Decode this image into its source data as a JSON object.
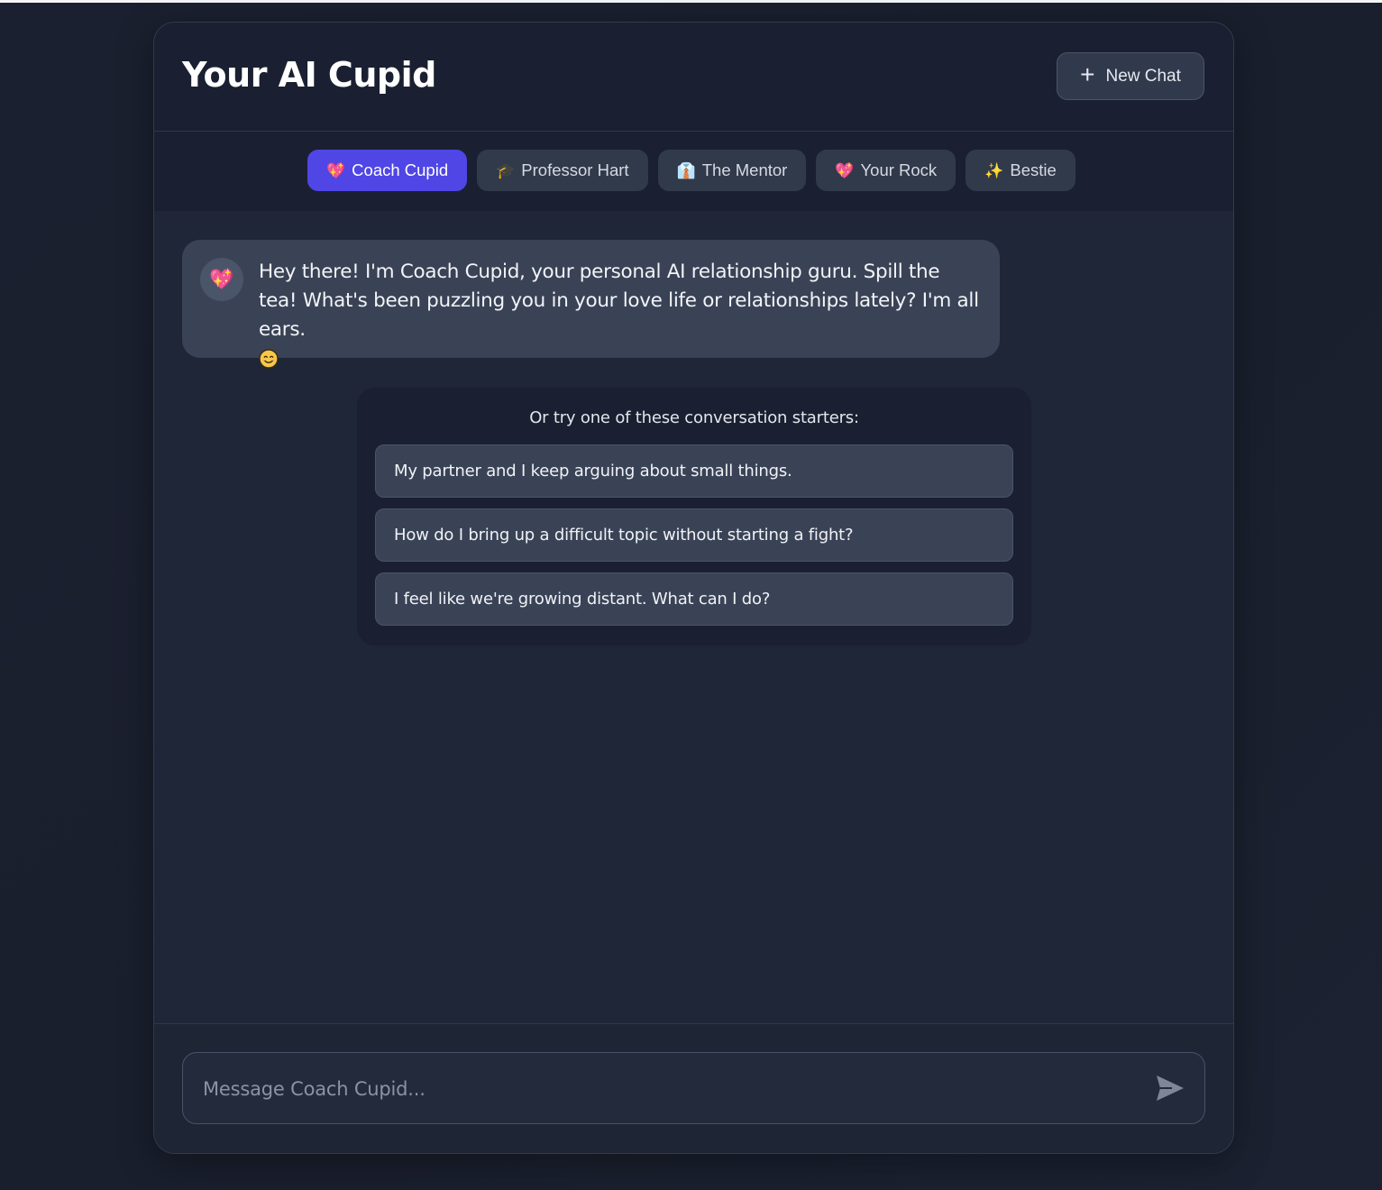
{
  "app": {
    "title": "Your AI Cupid",
    "new_chat_label": "New Chat"
  },
  "tabs": [
    {
      "label": "Coach Cupid",
      "icon": "heart-icon",
      "glyph": "💖",
      "active": true
    },
    {
      "label": "Professor Hart",
      "icon": "graduation-cap-icon",
      "glyph": "🎓",
      "active": false
    },
    {
      "label": "The Mentor",
      "icon": "person-icon",
      "glyph": "👔",
      "active": false
    },
    {
      "label": "Your Rock",
      "icon": "heart-icon",
      "glyph": "💖",
      "active": false
    },
    {
      "label": "Bestie",
      "icon": "sparkles-icon",
      "glyph": "✨",
      "active": false
    }
  ],
  "message": {
    "avatar_icon": "heart-icon",
    "avatar_glyph": "💖",
    "text": "Hey there! I'm Coach Cupid, your personal AI relationship guru. Spill the tea! What's been puzzling you in your love life or relationships lately? I'm all ears.",
    "emoji_icon": "smiling-face-icon"
  },
  "starters": {
    "title": "Or try one of these conversation starters:",
    "items": [
      "My partner and I keep arguing about small things.",
      "How do I bring up a difficult topic without starting a fight?",
      "I feel like we're growing distant. What can I do?"
    ]
  },
  "composer": {
    "placeholder": "Message Coach Cupid...",
    "value": "",
    "send_icon": "send-icon"
  },
  "colors": {
    "accent": "#4f46e5",
    "background": "#1a1f2c",
    "panel": "#1e2535",
    "bubble": "#3a4356"
  }
}
